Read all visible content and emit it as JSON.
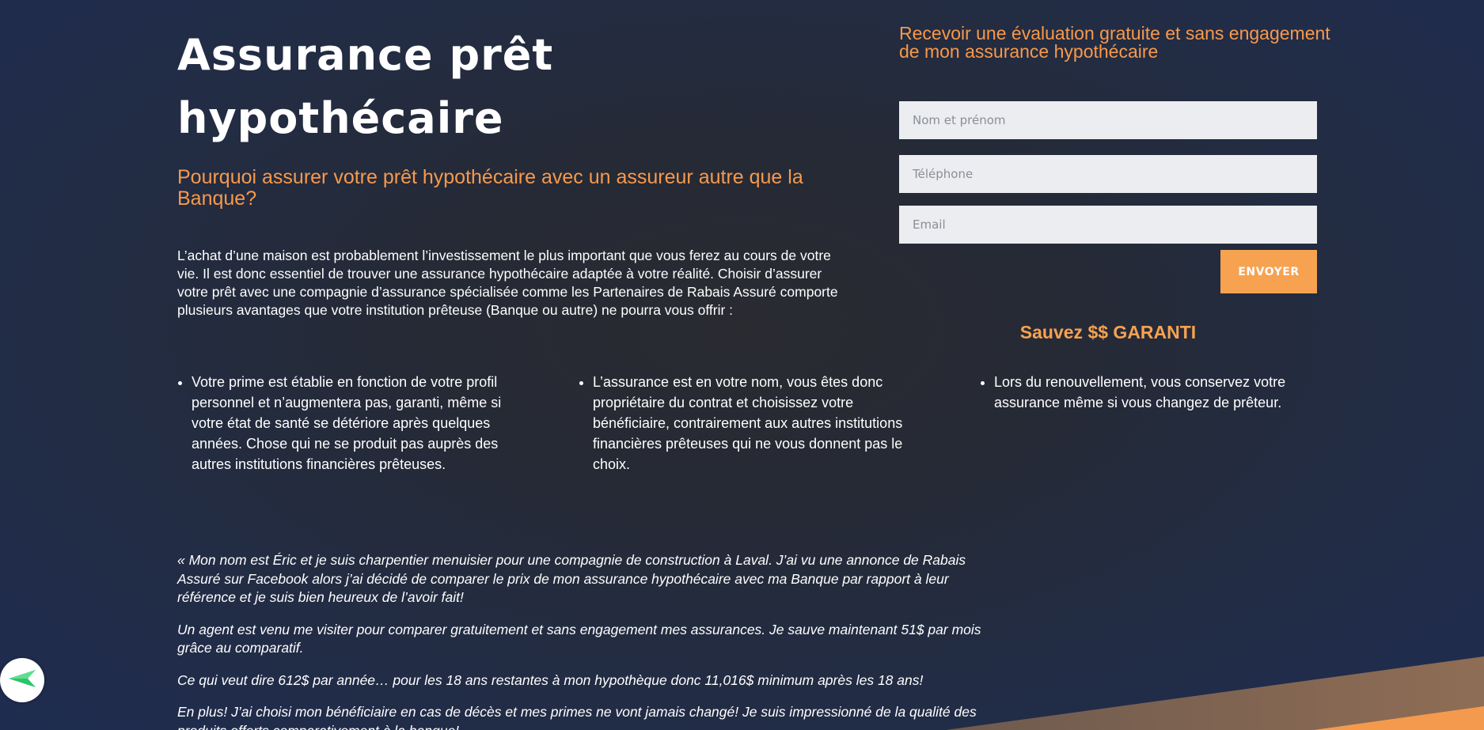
{
  "colors": {
    "accent": "#f7994c",
    "button": "#f7a251",
    "background_dark": "#1e2c50",
    "input_bg": "#ebedf0"
  },
  "hero": {
    "title": "Assurance prêt hypothécaire",
    "subtitle": "Pourquoi assurer votre prêt hypothécaire avec un assureur autre que la Banque?",
    "intro": "L’achat d’une maison est probablement l’investissement le plus important que vous ferez au cours de votre vie. Il est donc essentiel de trouver une assurance hypothécaire adaptée à votre réalité. Choisir d’assurer votre prêt avec une compagnie d’assurance spécialisée comme les Partenaires de Rabais Assuré comporte plusieurs avantages que votre institution prêteuse (Banque ou autre) ne pourra vous offrir :"
  },
  "benefits": [
    "Votre prime est établie en fonction de votre profil personnel et n’augmentera pas, garanti, même si votre état de santé se détériore après quelques années. Chose qui ne se produit pas auprès des autres institutions financières prêteuses.",
    "L’assurance est en votre nom, vous êtes donc propriétaire du contrat et choisissez votre bénéficiaire, contrairement aux autres institutions financières prêteuses qui ne vous donnent pas le choix.",
    "Lors du renouvellement, vous conservez votre assurance même si vous changez de prêteur."
  ],
  "testimonial": {
    "paragraphs": [
      "« Mon nom est Éric et je suis charpentier menuisier pour une compagnie de construction à Laval. J’ai vu une annonce de Rabais Assuré sur Facebook alors j’ai décidé de comparer le prix de mon assurance hypothécaire avec ma Banque par rapport à leur référence et je suis bien heureux de l’avoir fait!",
      "Un agent est venu me visiter pour comparer gratuitement et sans engagement mes assurances. Je sauve maintenant 51$ par mois grâce au comparatif.",
      "Ce qui veut dire 612$ par année… pour les 18 ans restantes à mon hypothèque donc 11,016$ minimum après les 18 ans!",
      "En plus! J’ai choisi mon bénéficiaire en cas de décès et mes primes ne vont jamais changé! Je suis impressionné de la qualité des produits offerts comparativement à la banque!"
    ]
  },
  "form": {
    "heading": "Recevoir une évaluation gratuite et sans engagement de mon assurance hypothécaire",
    "name_placeholder": "Nom et prénom",
    "phone_placeholder": "Téléphone",
    "email_placeholder": "Email",
    "submit_label": "ENVOYER",
    "guarantee": "Sauvez $$ GARANTI"
  },
  "icons": {
    "back": "back-arrow-icon"
  }
}
